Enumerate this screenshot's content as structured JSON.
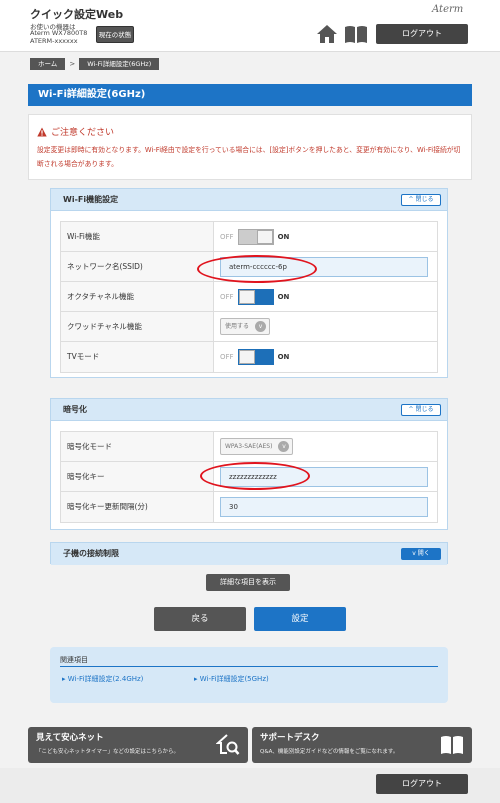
{
  "header": {
    "app_title": "クイック設定Web",
    "device_label": "お使いの機器は",
    "device_model": "Aterm WX7800T8",
    "device_id": "ATERM-xxxxxx",
    "status_button": "現在の状態",
    "brand": "Aterm",
    "logout": "ログアウト"
  },
  "breadcrumb": [
    "ホーム",
    "Wi-Fi詳細設定(6GHz)"
  ],
  "breadcrumb_sep": ">",
  "page_title": "Wi-Fi詳細設定(6GHz)",
  "notice": {
    "title": "ご注意ください",
    "body": "設定変更は即時に有効となります。Wi-Fi経由で設定を行っている場合には、[設定]ボタンを押したあと、変更が有効になり、Wi-Fi接続が切断される場合があります。"
  },
  "wifi_section": {
    "title": "Wi-Fi機能設定",
    "toggle_label": "閉じる",
    "wifi_function": {
      "label": "Wi-Fi機能",
      "off": "OFF",
      "on": "ON",
      "state": false
    },
    "ssid": {
      "label": "ネットワーク名(SSID)",
      "value": "aterm-cccccc-6p"
    },
    "octa_channel": {
      "label": "オクタチャネル機能",
      "off": "OFF",
      "on": "ON",
      "state": true
    },
    "quad_channel": {
      "label": "クワッドチャネル機能",
      "value": "使用する"
    },
    "tv_mode": {
      "label": "TVモード",
      "off": "OFF",
      "on": "ON",
      "state": true
    }
  },
  "encryption_section": {
    "title": "暗号化",
    "toggle_label": "閉じる",
    "mode": {
      "label": "暗号化モード",
      "value": "WPA3-SAE(AES)"
    },
    "key": {
      "label": "暗号化キー",
      "value": "zzzzzzzzzzzzz"
    },
    "key_interval": {
      "label": "暗号化キー更新間隔(分)",
      "value": "30"
    }
  },
  "child_section": {
    "title": "子機の接続制限",
    "toggle_label": "開く"
  },
  "buttons": {
    "detail": "詳細な項目を表示",
    "back": "戻る",
    "set": "設定"
  },
  "related": {
    "title": "関連項目",
    "link1": "Wi-Fi詳細設定(2.4GHz)",
    "link2": "Wi-Fi詳細設定(5GHz)"
  },
  "promo": {
    "left_title": "見えて安心ネット",
    "left_desc": "「こども安心ネットタイマー」などの設定はこちらから。",
    "right_title": "サポートデスク",
    "right_desc": "Q&A、機能別設定ガイドなどの情報をご覧になれます。"
  },
  "footer": {
    "logout": "ログアウト"
  },
  "colors": {
    "accent": "#1d74c6",
    "warning": "#c0392b",
    "highlight": "#e0141e"
  }
}
